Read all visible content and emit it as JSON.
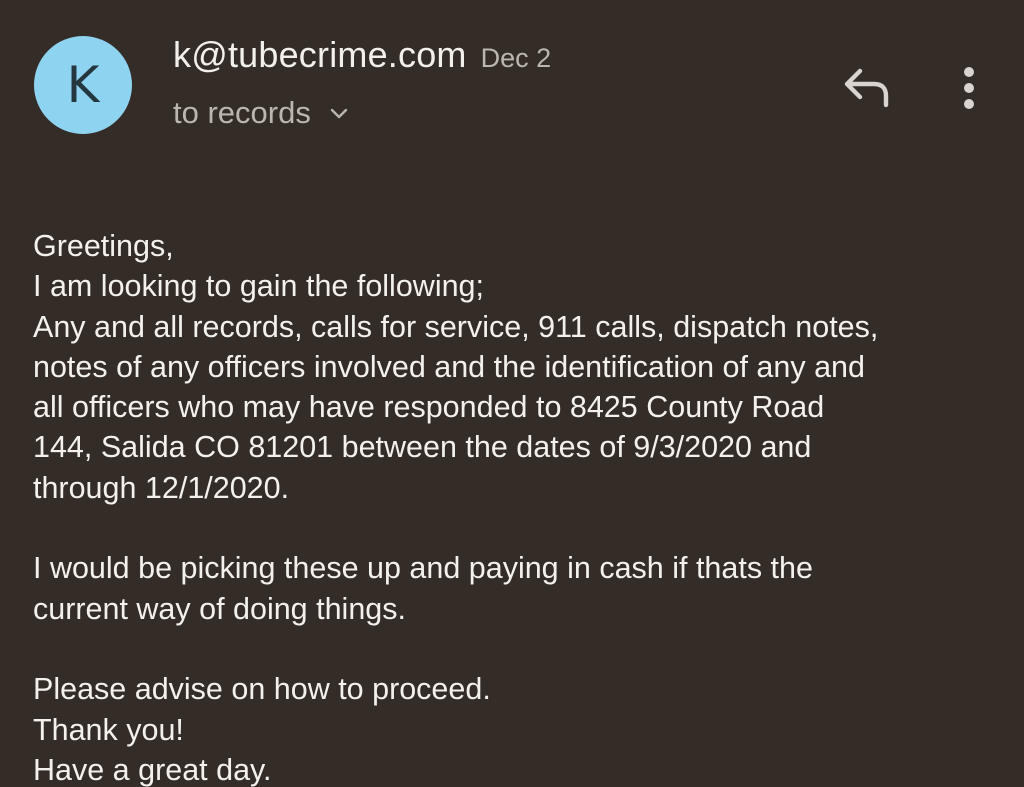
{
  "header": {
    "avatar_letter": "K",
    "sender": "k@tubecrime.com",
    "date": "Dec 2",
    "recipient": "to records",
    "reply_icon": "reply-icon",
    "more_icon": "more-vert-icon",
    "colors": {
      "background": "#332c27",
      "avatar": "#8ed3f0"
    }
  },
  "message": {
    "greeting": "Greetings,",
    "line1": "I am looking to gain the following;",
    "para1_l1": "Any and all records, calls for service, 911 calls, dispatch notes,",
    "para1_l2": "notes of any officers involved and the identification of any and",
    "para1_l3": "all officers who may have responded to 8425 County Road",
    "para1_l4": "144, Salida CO 81201 between the dates of 9/3/2020 and",
    "para1_l5": "through 12/1/2020.",
    "para2_l1": "I would be picking these up and paying in cash if thats the",
    "para2_l2": "current way of doing things.",
    "closing1": "Please advise on how to proceed.",
    "closing2": "Thank you!",
    "closing3": "Have a great day."
  }
}
